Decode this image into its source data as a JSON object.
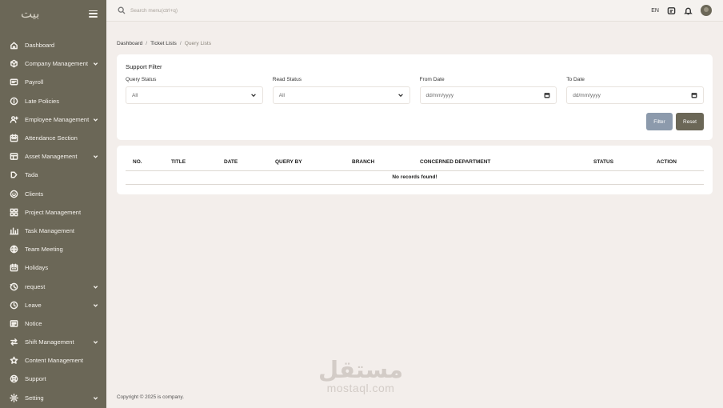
{
  "app": {
    "logo_text": "بيت"
  },
  "sidebar": {
    "items": [
      {
        "label": "Dashboard",
        "icon": "home-icon",
        "has_submenu": false
      },
      {
        "label": "Company Management",
        "icon": "building-icon",
        "has_submenu": true
      },
      {
        "label": "Payroll",
        "icon": "payroll-icon",
        "has_submenu": false
      },
      {
        "label": "Late Policies",
        "icon": "info-icon",
        "has_submenu": false
      },
      {
        "label": "Employee Management",
        "icon": "user-add-icon",
        "has_submenu": true
      },
      {
        "label": "Attendance Section",
        "icon": "calendar-icon",
        "has_submenu": false
      },
      {
        "label": "Asset Management",
        "icon": "asset-icon",
        "has_submenu": true
      },
      {
        "label": "Tada",
        "icon": "tag-icon",
        "has_submenu": false
      },
      {
        "label": "Clients",
        "icon": "smile-icon",
        "has_submenu": false
      },
      {
        "label": "Project Management",
        "icon": "grid-icon",
        "has_submenu": false
      },
      {
        "label": "Task Management",
        "icon": "chart-icon",
        "has_submenu": false
      },
      {
        "label": "Team Meeting",
        "icon": "globe-icon",
        "has_submenu": false
      },
      {
        "label": "Holidays",
        "icon": "holiday-icon",
        "has_submenu": false
      },
      {
        "label": "request",
        "icon": "request-icon",
        "has_submenu": true
      },
      {
        "label": "Leave",
        "icon": "clock-icon",
        "has_submenu": true
      },
      {
        "label": "Notice",
        "icon": "notice-icon",
        "has_submenu": false
      },
      {
        "label": "Shift Management",
        "icon": "swap-icon",
        "has_submenu": true
      },
      {
        "label": "Content Management",
        "icon": "star-icon",
        "has_submenu": false
      },
      {
        "label": "Support",
        "icon": "support-icon",
        "has_submenu": false
      },
      {
        "label": "Setting",
        "icon": "gear-icon",
        "has_submenu": true
      }
    ]
  },
  "header": {
    "search_placeholder": "Search menu(ctrl+q)",
    "language": "EN"
  },
  "breadcrumb": {
    "items": [
      "Dashboard",
      "Ticket Lists",
      "Query Lists"
    ]
  },
  "filter": {
    "title": "Support Filter",
    "query_status_label": "Query Status",
    "query_status_value": "All",
    "read_status_label": "Read Status",
    "read_status_value": "All",
    "from_date_label": "From Date",
    "from_date_placeholder": "dd/mm/yyyy",
    "to_date_label": "To Date",
    "to_date_placeholder": "dd/mm/yyyy",
    "filter_button": "Filter",
    "reset_button": "Reset"
  },
  "table": {
    "columns": [
      "NO.",
      "TITLE",
      "DATE",
      "QUERY BY",
      "BRANCH",
      "CONCERNED DEPARTMENT",
      "STATUS",
      "ACTION"
    ],
    "empty_message": "No records found!"
  },
  "footer": {
    "copyright": "Copyright © 2025 is company."
  },
  "watermark": {
    "arabic": "مستقل",
    "latin": "mostaql.com"
  },
  "colors": {
    "sidebar_bg": "#6b6757",
    "page_bg": "#f3eeeb",
    "filter_button": "#8c9aac",
    "reset_button": "#6b6757"
  }
}
